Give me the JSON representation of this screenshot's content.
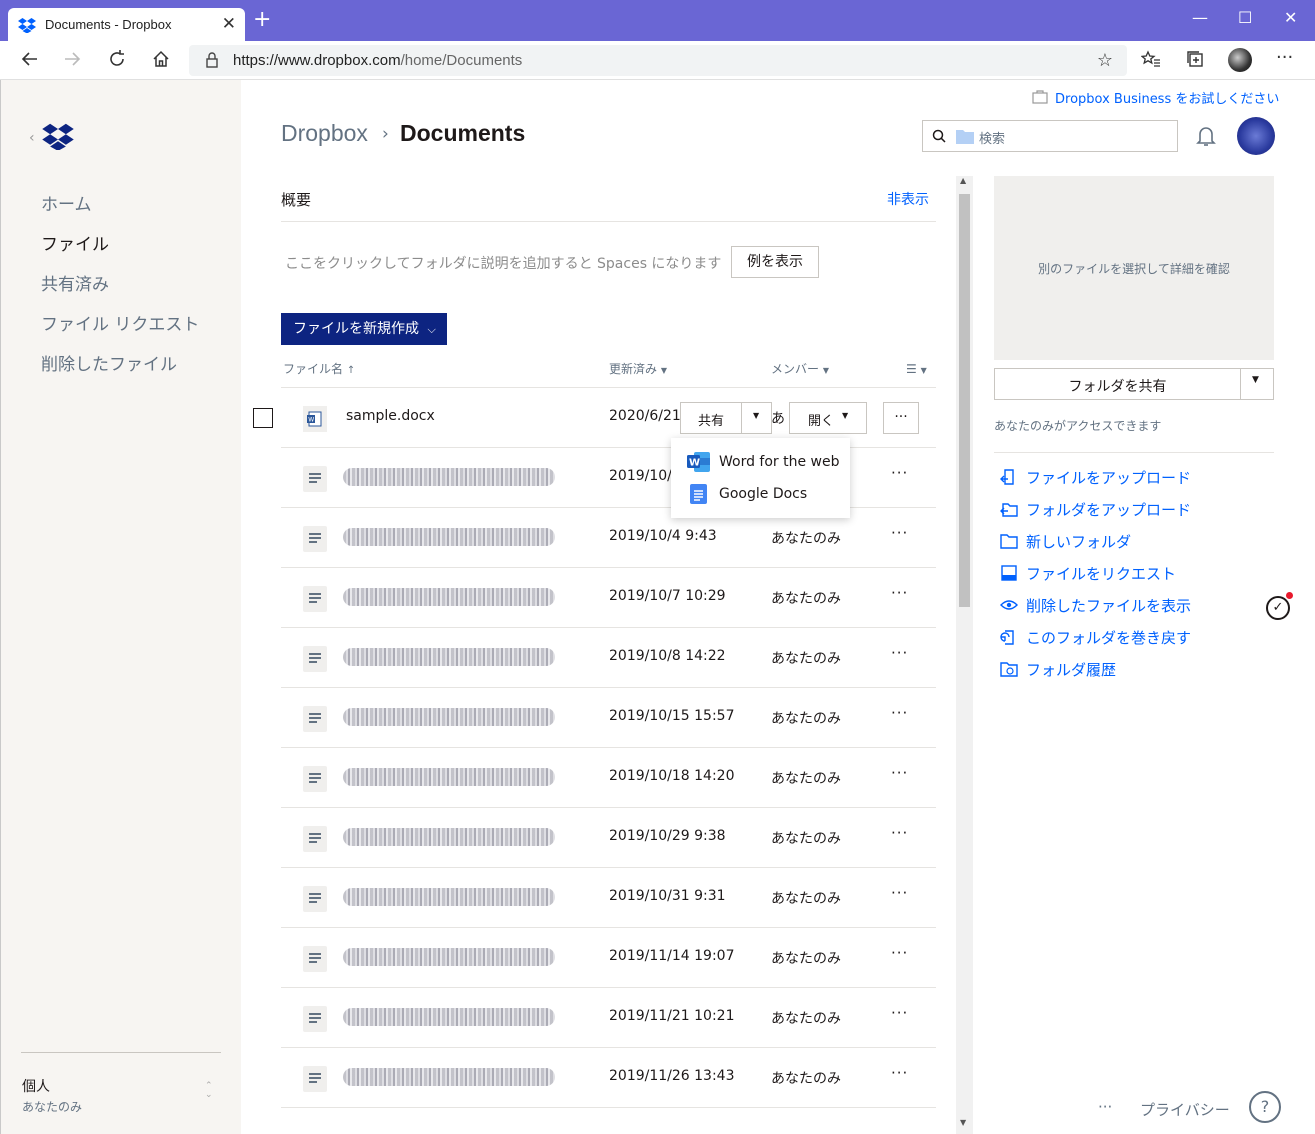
{
  "browser": {
    "tab_title": "Documents - Dropbox",
    "url_host": "https://www.dropbox.com",
    "url_path": "/home/Documents"
  },
  "sidebar": {
    "items": [
      {
        "label": "ホーム"
      },
      {
        "label": "ファイル"
      },
      {
        "label": "共有済み"
      },
      {
        "label": "ファイル リクエスト"
      },
      {
        "label": "削除したファイル"
      }
    ],
    "account_name": "個人",
    "account_sub": "あなたのみ"
  },
  "header": {
    "trial_link": "Dropbox Business をお試しください",
    "breadcrumb_root": "Dropbox",
    "breadcrumb_current": "Documents",
    "search_placeholder": "検索"
  },
  "overview": {
    "title": "概要",
    "hide": "非表示",
    "hint": "ここをクリックしてフォルダに説明を追加すると Spaces になります",
    "example_button": "例を表示"
  },
  "new_file_button": "ファイルを新規作成",
  "columns": {
    "name": "ファイル名",
    "modified": "更新済み",
    "members": "メンバー"
  },
  "first_row": {
    "name": "sample.docx",
    "date": "2020/6/21",
    "member_partial": "あ",
    "share_label": "共有",
    "open_label": "開く"
  },
  "dropdown": {
    "items": [
      "Word for the web",
      "Google Docs"
    ]
  },
  "rows": [
    {
      "date": "2019/10/4",
      "member": ""
    },
    {
      "date": "2019/10/4 9:43",
      "member": "あなたのみ"
    },
    {
      "date": "2019/10/7 10:29",
      "member": "あなたのみ"
    },
    {
      "date": "2019/10/8 14:22",
      "member": "あなたのみ"
    },
    {
      "date": "2019/10/15 15:57",
      "member": "あなたのみ"
    },
    {
      "date": "2019/10/18 14:20",
      "member": "あなたのみ"
    },
    {
      "date": "2019/10/29 9:38",
      "member": "あなたのみ"
    },
    {
      "date": "2019/10/31 9:31",
      "member": "あなたのみ"
    },
    {
      "date": "2019/11/14 19:07",
      "member": "あなたのみ"
    },
    {
      "date": "2019/11/21 10:21",
      "member": "あなたのみ"
    },
    {
      "date": "2019/11/26 13:43",
      "member": "あなたのみ"
    }
  ],
  "right_panel": {
    "preview_text": "別のファイルを選択して詳細を確認",
    "share_folder": "フォルダを共有",
    "access_text": "あなたのみがアクセスできます",
    "actions": [
      {
        "label": "ファイルをアップロード",
        "icon": "upload-file-icon"
      },
      {
        "label": "フォルダをアップロード",
        "icon": "upload-folder-icon"
      },
      {
        "label": "新しいフォルダ",
        "icon": "new-folder-icon"
      },
      {
        "label": "ファイルをリクエスト",
        "icon": "request-file-icon"
      },
      {
        "label": "削除したファイルを表示",
        "icon": "eye-icon"
      },
      {
        "label": "このフォルダを巻き戻す",
        "icon": "rewind-icon"
      },
      {
        "label": "フォルダ履歴",
        "icon": "history-icon"
      }
    ]
  },
  "footer": {
    "more": "···",
    "privacy": "プライバシー",
    "help": "?"
  },
  "colors": {
    "accent": "#0061fe",
    "primary_button": "#0d2481",
    "browser_frame": "#6a66d4"
  }
}
